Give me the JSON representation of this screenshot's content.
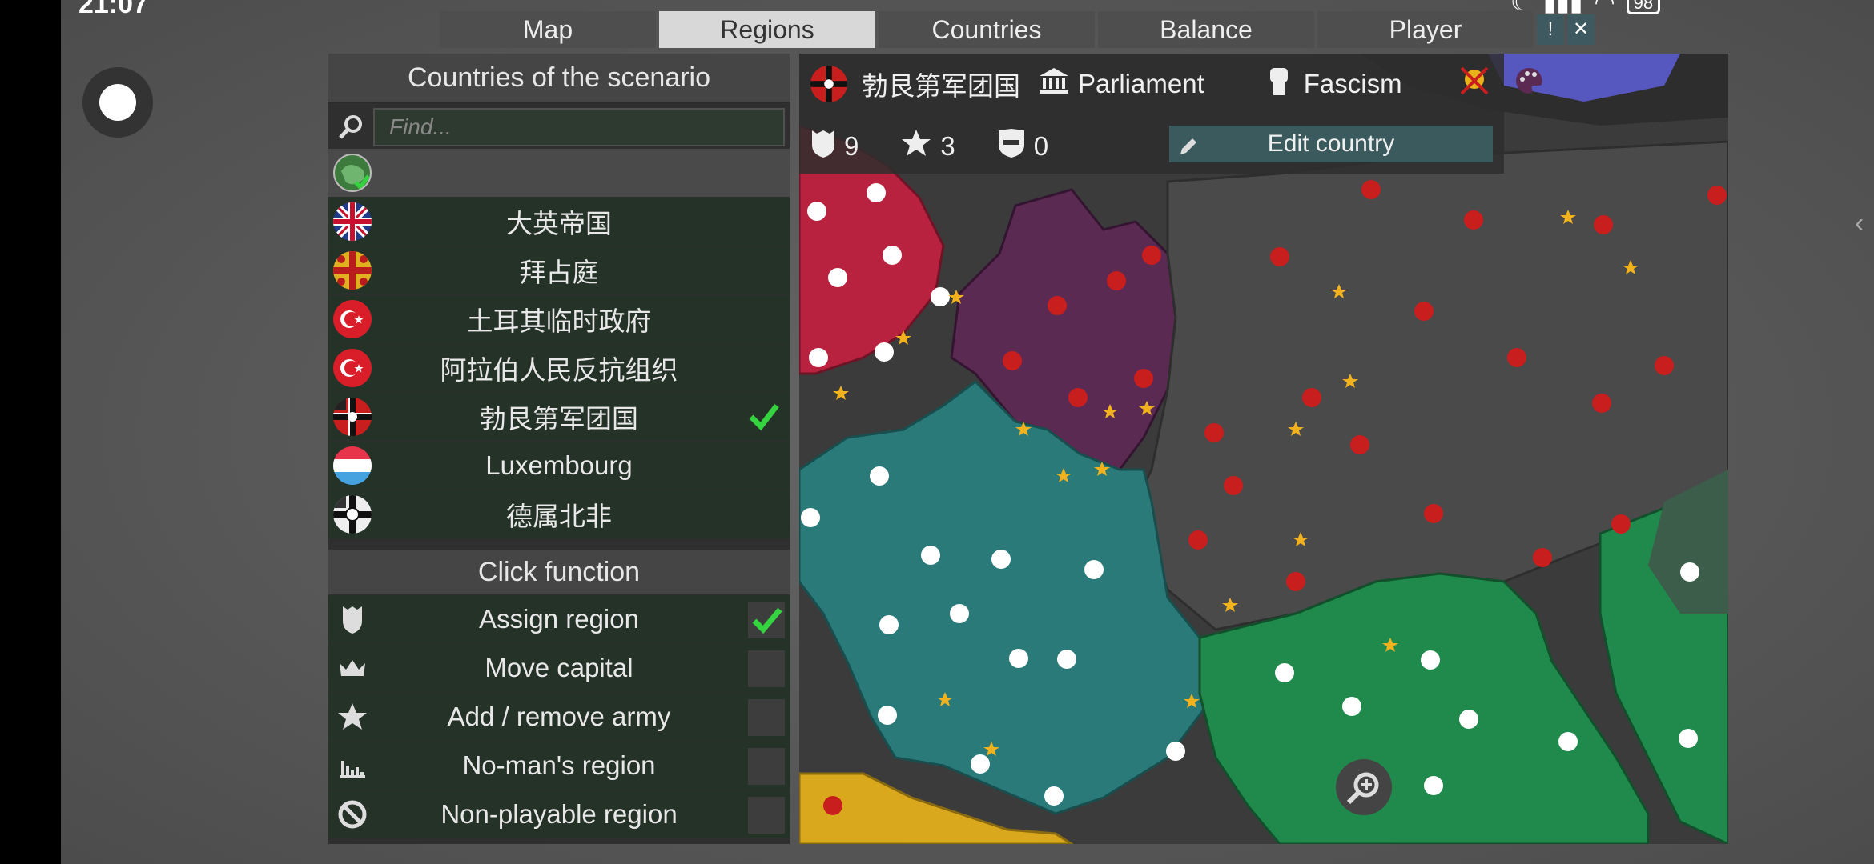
{
  "status_bar": {
    "time": "21:07",
    "battery": "98"
  },
  "top_tabs": [
    "Map",
    "Regions",
    "Countries",
    "Balance",
    "Player"
  ],
  "active_tab": "Regions",
  "small_buttons": {
    "info": "!",
    "close": "✕"
  },
  "left_panel": {
    "title": "Countries of the scenario",
    "search_placeholder": "Find...",
    "countries": [
      {
        "name": "大英帝国",
        "flag": "union-jack",
        "selected": false
      },
      {
        "name": "拜占庭",
        "flag": "byzantine",
        "selected": false
      },
      {
        "name": "土耳其临时政府",
        "flag": "turkey",
        "selected": false
      },
      {
        "name": "阿拉伯人民反抗组织",
        "flag": "turkey",
        "selected": false
      },
      {
        "name": "勃艮第军团国",
        "flag": "german-war-ensign",
        "selected": true
      },
      {
        "name": "Luxembourg",
        "flag": "luxembourg",
        "selected": false
      },
      {
        "name": "德属北非",
        "flag": "german-colonial",
        "selected": false
      }
    ],
    "click_function_title": "Click function",
    "functions": [
      {
        "label": "Assign region",
        "icon": "shield-icon",
        "checked": true
      },
      {
        "label": "Move capital",
        "icon": "crown-icon",
        "checked": false
      },
      {
        "label": "Add / remove army",
        "icon": "star-icon",
        "checked": false
      },
      {
        "label": "No-man's region",
        "icon": "ruins-icon",
        "checked": false
      },
      {
        "label": "Non-playable region",
        "icon": "prohibit-icon",
        "checked": false
      }
    ]
  },
  "map_header": {
    "country": "勃艮第军团国",
    "government": "Parliament",
    "ideology": "Fascism",
    "regions_count": "9",
    "armies_count": "3",
    "defense_count": "0",
    "edit_button": "Edit country"
  },
  "colors": {
    "britain": "#b8223f",
    "burgundy": "#5b2a52",
    "france": "#2a7a7a",
    "germany": "#3c3c3c",
    "italy": "#1f8a4c",
    "spain": "#d9a81d",
    "check_green": "#34d33f"
  }
}
